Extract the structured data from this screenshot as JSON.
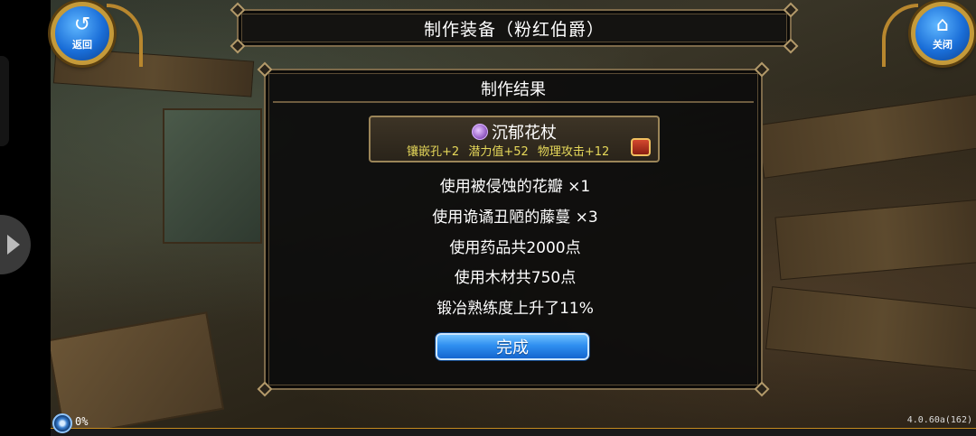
{
  "header": {
    "title": "制作装备（粉红伯爵）",
    "back_label": "返回",
    "close_label": "关闭"
  },
  "dialog": {
    "title": "制作结果",
    "item": {
      "name": "沉郁花杖",
      "stats": [
        "镶嵌孔+2",
        "潜力值+52",
        "物理攻击+12"
      ]
    },
    "results": [
      "使用被侵蚀的花瓣 ×1",
      "使用诡谲丑陋的藤蔓 ×3",
      "使用药品共2000点",
      "使用木材共750点",
      "锻冶熟练度上升了11%"
    ],
    "done_label": "完成"
  },
  "status": {
    "progress": "0%",
    "version": "4.0.60a(162)"
  },
  "icons": {
    "back": "back-arrow-icon",
    "close": "home-icon",
    "item": "staff-icon",
    "chest": "treasure-chest-icon",
    "progress": "loading-orb-icon"
  },
  "colors": {
    "accent_blue": "#2f8ff0",
    "frame_gold": "#c49a3a",
    "stat_yellow": "#e6d85a"
  }
}
